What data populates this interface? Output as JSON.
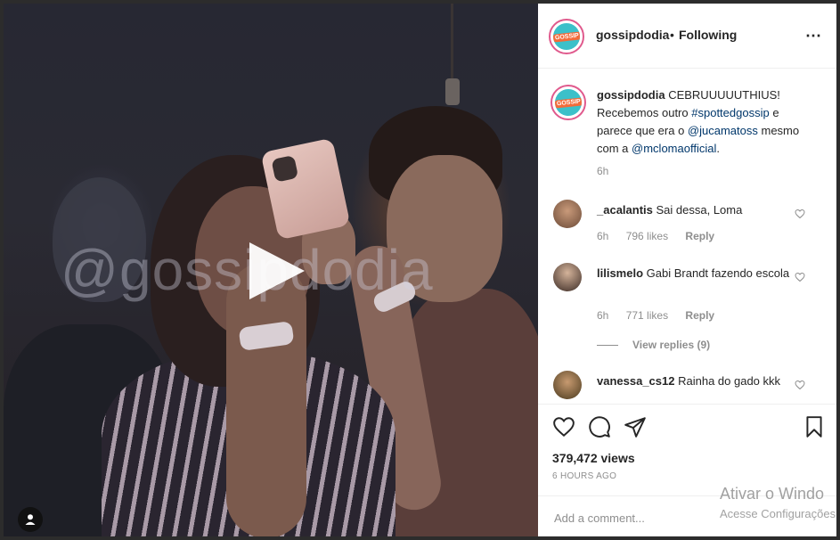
{
  "video": {
    "watermark": "@gossipdodia"
  },
  "header": {
    "username": "gossipdodia",
    "separator": "•",
    "follow_status": "Following",
    "more_icon": "⋯",
    "logo_text": "GOSSIP"
  },
  "caption": {
    "username": "gossipdodia",
    "text_1": "CEBRUUUUUTHIUS! Recebemos outro",
    "hashtag": "#spottedgossip",
    "text_2": "e parece que era o",
    "mention_1": "@jucamatoss",
    "text_3": "mesmo com a",
    "mention_2": "@mcloma​official",
    "text_4": ".",
    "time": "6h"
  },
  "comments": [
    {
      "username": "_acalantis",
      "text": "Sai dessa, Loma",
      "time": "6h",
      "likes": "796 likes",
      "reply": "Reply"
    },
    {
      "username": "lilismelo",
      "text": "Gabi Brandt fazendo escola",
      "time": "6h",
      "likes": "771 likes",
      "reply": "Reply",
      "view_replies": "View replies (9)"
    },
    {
      "username": "vanessa_cs12",
      "text": "Rainha do gado kkk"
    }
  ],
  "actions": {
    "views": "379,472 views",
    "time_ago": "6 HOURS AGO"
  },
  "add_comment": {
    "placeholder": "Add a comment..."
  },
  "overlay": {
    "line1": "Ativar o Windo",
    "line2": "Acesse Configurações"
  }
}
